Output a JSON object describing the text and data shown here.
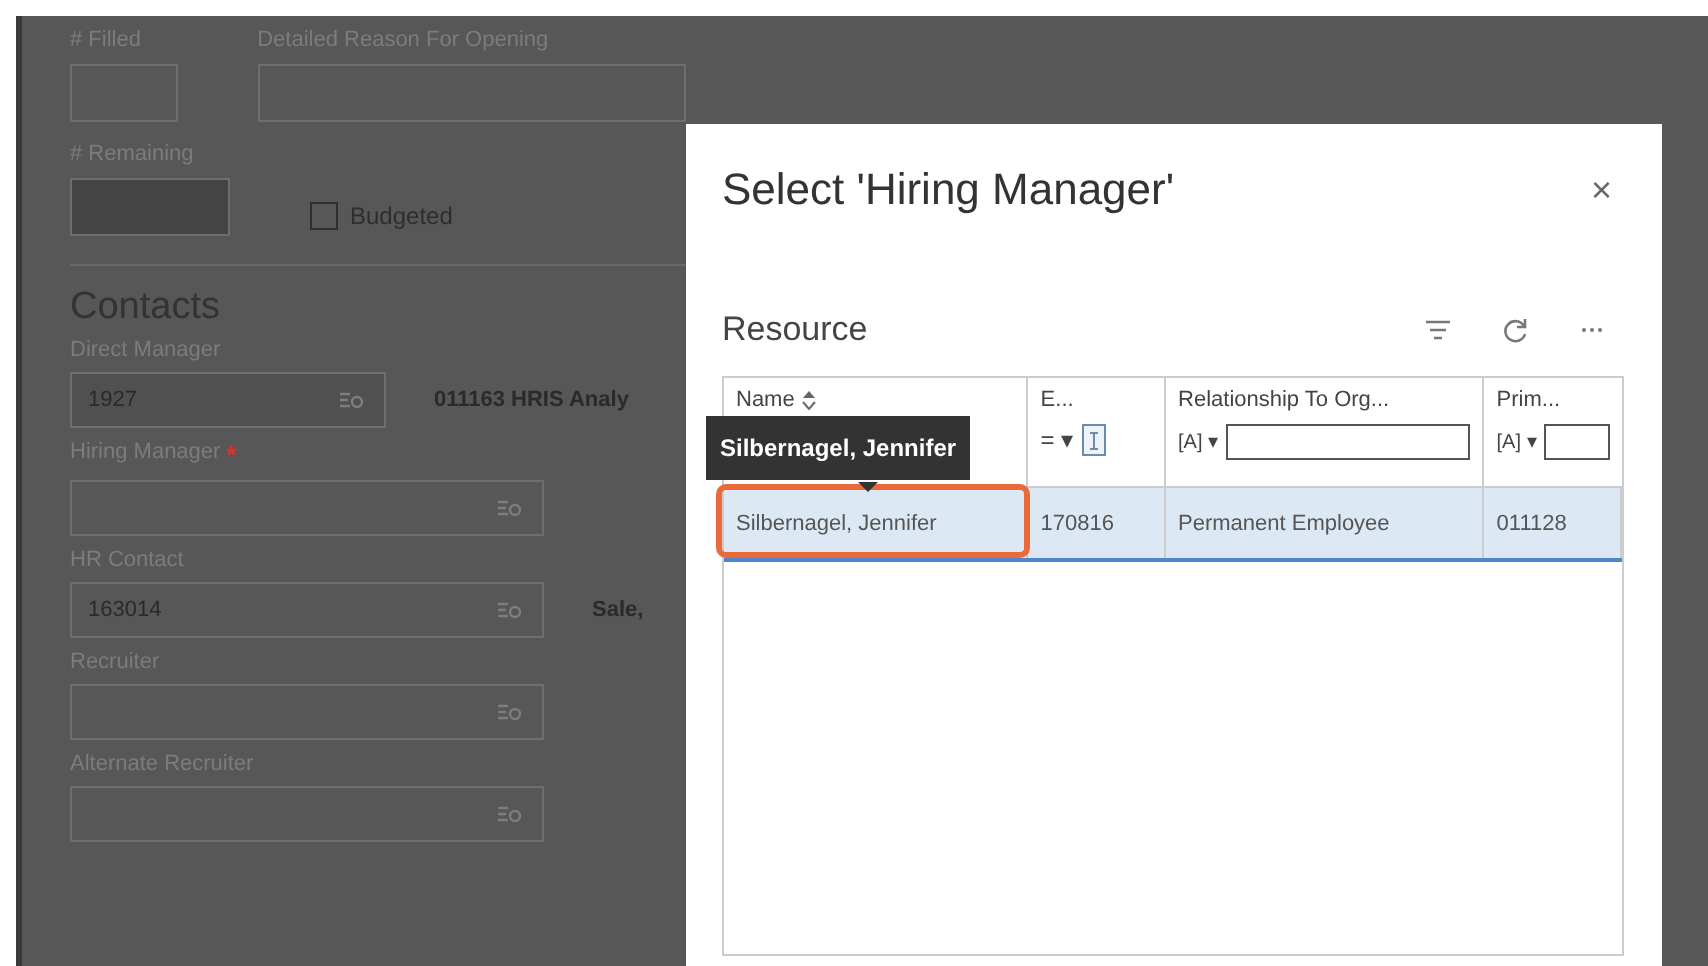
{
  "form": {
    "top_row": [
      {
        "label": "# Filled",
        "kind": "short"
      },
      {
        "label": "Detailed Reason For Opening",
        "kind": "wide"
      }
    ],
    "second_row": {
      "field": {
        "label": "# Remaining",
        "disabled": true
      },
      "checkbox": {
        "label": "Budgeted",
        "checked": false
      }
    },
    "section_title": "Contacts",
    "lookups": [
      {
        "label": "Direct Manager",
        "value": "1927",
        "disabled": true,
        "side_text": "011163 HRIS Analy"
      },
      {
        "label": "Hiring Manager",
        "required_mark": "*",
        "disabled": false
      },
      {
        "label": "HR Contact",
        "value": "163014",
        "disabled": false,
        "side_text": "Sale,"
      },
      {
        "label": "Recruiter",
        "disabled": false
      },
      {
        "label": "Alternate Recruiter",
        "disabled": false
      }
    ]
  },
  "dialog": {
    "title": "Select 'Hiring Manager'",
    "close": "×",
    "grid_title": "Resource",
    "columns": [
      {
        "label": "Name",
        "sortable": true,
        "kind": "plain"
      },
      {
        "label": "E...",
        "kind": "numeric",
        "operator": "= ▾"
      },
      {
        "label": "Relationship To Org...",
        "kind": "textual",
        "operator": "[A] ▾"
      },
      {
        "label": "Prim...",
        "kind": "textual",
        "operator": "[A] ▾"
      }
    ],
    "rows": [
      {
        "selected": true,
        "annotated": true,
        "cells": [
          "Silbernagel, Jennifer",
          "170816",
          "Permanent Employee",
          "011128"
        ]
      }
    ],
    "tooltip": "Silbernagel, Jennifer"
  }
}
